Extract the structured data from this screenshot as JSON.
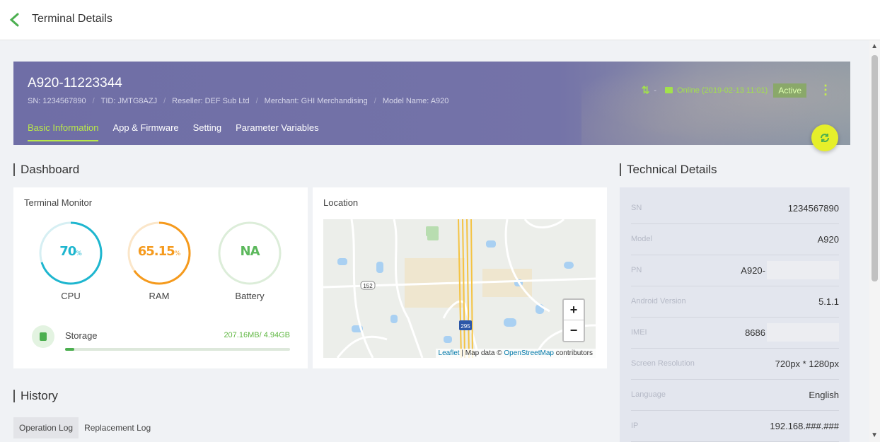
{
  "header": {
    "back_icon": "chevron-left-icon",
    "title": "Terminal Details"
  },
  "terminal": {
    "name": "A920-11223344",
    "meta": [
      "SN: 1234567890",
      "TID: JMTG8AZJ",
      "Reseller: DEF Sub Ltd",
      "Merchant: GHI Merchandising",
      "Model Name: A920"
    ],
    "tabs": [
      "Basic Information",
      "App & Firmware",
      "Setting",
      "Parameter Variables"
    ],
    "active_tab": "Basic Information",
    "dash": "-",
    "online_text": "Online (2019-02-13 11:01)",
    "status_badge": "Active",
    "accent_color": "#b9e84a",
    "banner_color": "#7372a8",
    "sync_button_color": "#e6ef2a"
  },
  "dashboard": {
    "title": "Dashboard",
    "monitor": {
      "title": "Terminal Monitor",
      "gauges": [
        {
          "label": "CPU",
          "value": "70",
          "unit": "%",
          "fraction": 0.7,
          "color": "#1eb6cf",
          "track": "#d6eff3"
        },
        {
          "label": "RAM",
          "value": "65.15",
          "unit": "%",
          "fraction": 0.6515,
          "color": "#f59a1d",
          "track": "#fbe6c9"
        },
        {
          "label": "Battery",
          "value": "NA",
          "unit": "",
          "fraction": 0,
          "color": "#5cb85c",
          "track": "#dcedd9"
        }
      ],
      "storage": {
        "label": "Storage",
        "value": "207.16MB/ 4.94GB",
        "fraction": 0.04
      }
    },
    "location": {
      "title": "Location",
      "zoom_in": "+",
      "zoom_out": "−",
      "route_1": "152",
      "route_2": "295",
      "attribution_leaflet": "Leaflet",
      "attribution_mid": " | Map data © ",
      "attribution_osm": "OpenStreetMap",
      "attribution_end": " contributors"
    }
  },
  "technical": {
    "title": "Technical Details",
    "rows": [
      {
        "label": "SN",
        "value": "1234567890"
      },
      {
        "label": "Model",
        "value": "A920"
      },
      {
        "label": "PN",
        "value": "A920-"
      },
      {
        "label": "Android Version",
        "value": "5.1.1"
      },
      {
        "label": "IMEI",
        "value": "8686"
      },
      {
        "label": "Screen Resolution",
        "value": "720px * 1280px"
      },
      {
        "label": "Language",
        "value": "English"
      },
      {
        "label": "IP",
        "value": "192.168.###.###"
      }
    ]
  },
  "history": {
    "title": "History",
    "tabs": [
      "Operation Log",
      "Replacement Log"
    ],
    "active_tab": "Operation Log"
  }
}
